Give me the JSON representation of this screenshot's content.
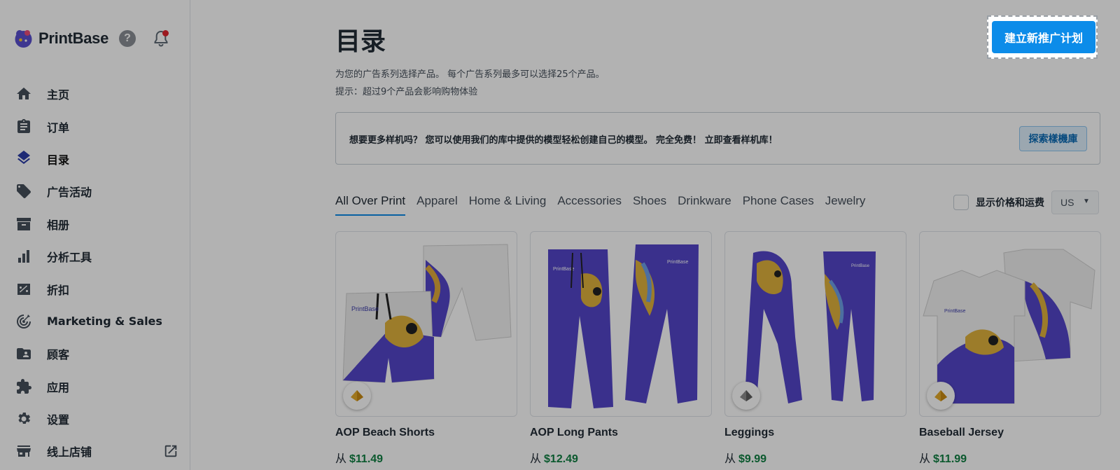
{
  "brand": {
    "name": "PrintBase"
  },
  "colors": {
    "accent": "#0c8ce9",
    "price": "#108043",
    "brand_purple": "#5a4fcf",
    "notification": "#e0242e"
  },
  "sidebar": {
    "items": [
      {
        "label": "主页",
        "icon": "home-icon"
      },
      {
        "label": "订单",
        "icon": "clipboard-icon"
      },
      {
        "label": "目录",
        "icon": "layers-icon",
        "active": true
      },
      {
        "label": "广告活动",
        "icon": "tags-icon"
      },
      {
        "label": "相册",
        "icon": "archive-icon"
      },
      {
        "label": "分析工具",
        "icon": "bar-chart-icon"
      },
      {
        "label": "折扣",
        "icon": "discount-icon"
      },
      {
        "label": "Marketing & Sales",
        "icon": "target-icon"
      },
      {
        "label": "顾客",
        "icon": "customer-icon"
      },
      {
        "label": "应用",
        "icon": "puzzle-icon"
      },
      {
        "label": "设置",
        "icon": "gear-icon"
      },
      {
        "label": "线上店铺",
        "icon": "store-icon"
      }
    ]
  },
  "header": {
    "title": "目录",
    "subtitle": "为您的广告系列选择产品。 每个广告系列最多可以选择25个产品。",
    "hint": "提示：超过9个产品会影响购物体验",
    "create_button": "建立新推广计划"
  },
  "banner": {
    "text": "想要更多样机吗？ 您可以使用我们的库中提供的模型轻松创建自己的模型。 完全免费！ 立即查看样机库！",
    "button": "探索樣機庫"
  },
  "tabs": [
    "All Over Print",
    "Apparel",
    "Home & Living",
    "Accessories",
    "Shoes",
    "Drinkware",
    "Phone Cases",
    "Jewelry"
  ],
  "active_tab": "All Over Print",
  "price_toggle": {
    "label": "显示价格和运费",
    "checked": false
  },
  "currency": {
    "value": "US"
  },
  "products": [
    {
      "name": "AOP Beach Shorts",
      "prefix": "从",
      "price": "$11.49",
      "badge": "gold-diamond-icon"
    },
    {
      "name": "AOP Long Pants",
      "prefix": "从",
      "price": "$12.49",
      "badge": "gold-diamond-icon"
    },
    {
      "name": "Leggings",
      "prefix": "从",
      "price": "$9.99",
      "badge": "silver-diamond-icon"
    },
    {
      "name": "Baseball Jersey",
      "prefix": "从",
      "price": "$11.99",
      "badge": "gold-diamond-icon"
    }
  ]
}
